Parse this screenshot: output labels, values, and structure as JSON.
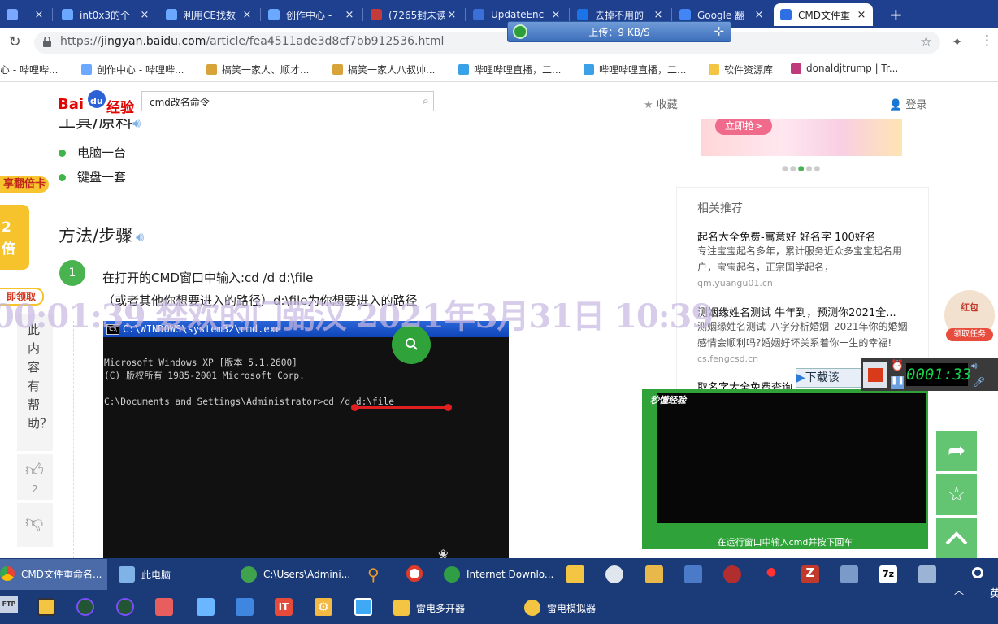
{
  "browser": {
    "tabs": [
      {
        "label": "— — —",
        "color": "#7aa7ff"
      },
      {
        "label": "int0x3的个",
        "color": "#6aa9ff"
      },
      {
        "label": "利用CE找数",
        "color": "#6aa9ff"
      },
      {
        "label": "创作中心 -",
        "color": "#6aa9ff"
      },
      {
        "label": "(7265封未读",
        "color": "#c43b3b"
      },
      {
        "label": "UpdateEnc",
        "color": "#3b6fd9"
      },
      {
        "label": "去掉不用的",
        "color": "#1b73e8"
      },
      {
        "label": "Google 翻",
        "color": "#4285f4"
      },
      {
        "label": "CMD文件重",
        "color": "#2f6fe4"
      }
    ],
    "new_tab": "+",
    "url_scheme": "https://",
    "url_host": "jingyan.baidu.com",
    "url_path": "/article/fea4511ade3d8cf7bb912536.html",
    "upload_speed": "上传：9 KB/S",
    "bookmarks": [
      "心 - 哔哩哔...",
      "创作中心 - 哔哩哔...",
      "搞笑一家人、顺才...",
      "搞笑一家人八叔帅...",
      "哔哩哔哩直播，二...",
      "哔哩哔哩直播，二...",
      "软件资源库",
      "donaldjtrump | Tr..."
    ]
  },
  "site": {
    "logo_bai": "Bai",
    "logo_du": "du",
    "logo_jy": "经验",
    "search_value": "cmd改名命令",
    "favorite": "收藏",
    "login": "登录"
  },
  "article": {
    "tools_heading": "工具/原料",
    "tools": [
      "电脑一台",
      "键盘一套"
    ],
    "steps_heading": "方法/步骤",
    "step_number": "1",
    "step_line1": "在打开的CMD窗口中输入:cd /d d:\\file",
    "step_line2": "（或者其他你想要进入的路径）d:\\file为你想要进入的路径",
    "cmd_title": "C:\\WINDOWS\\system32\\cmd.exe",
    "cmd_lines": [
      "Microsoft Windows XP [版本 5.1.2600]",
      "(C) 版权所有 1985-2001 Microsoft Corp.",
      "",
      "C:\\Documents and Settings\\Administrator>cd /d d:\\file_"
    ]
  },
  "left_bar": {
    "promo_card": "享翻倍卡",
    "promo_num": "2",
    "promo_unit": "倍",
    "promo_claim": "即领取",
    "helpful_q": "此内容有帮助？",
    "like_count": "2"
  },
  "sidebar": {
    "banner_button": "立即抢>",
    "related_title": "相关推荐",
    "recs": [
      {
        "title": "起名大全免费-寓意好 好名字 100好名",
        "desc": "专注宝宝起名多年，累计服务近众多宝宝起名用户，宝宝起名，正宗国学起名，",
        "source": "qm.yuangu01.cn"
      },
      {
        "title": "测姻缘姓名测试 牛年到，预测你2021全...",
        "desc": "测姻缘姓名测试_八字分析婚姻_2021年你的婚姻感情会顺利吗?婚姻好坏关系着你一生的幸福!",
        "source": "cs.fengcsd.cn"
      },
      {
        "title": "取名字大全免费查询",
        "desc": "",
        "source": ""
      }
    ],
    "redpacket": "红包",
    "redpacket_task": "领取任务"
  },
  "overlay": {
    "watermark": "00:01:39 婪欢的门弼汉 2021年3月31日 10:39",
    "video_logo": "秒懂经验",
    "video_caption": "在运行窗口中输入cmd并按下回车",
    "download_btn": "下载该",
    "timer": "0001:33"
  },
  "taskbar": {
    "row1": [
      {
        "label": "CMD文件重命名..."
      },
      {
        "label": "此电脑"
      },
      {
        "label": "C:\\Users\\Admini..."
      },
      {
        "label": "Internet Downlo..."
      }
    ],
    "row2": [
      {
        "label": "雷电多开器"
      },
      {
        "label": "雷电模拟器"
      }
    ],
    "tray_char": "英",
    "ftp": "FTP"
  }
}
